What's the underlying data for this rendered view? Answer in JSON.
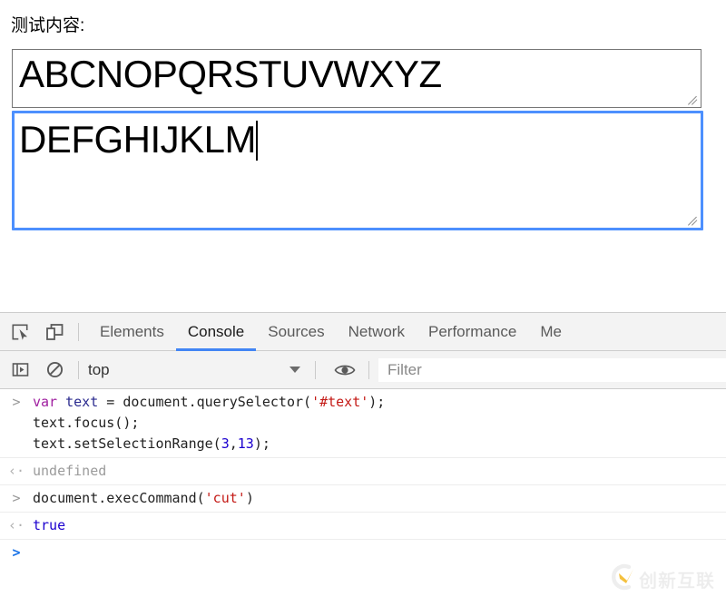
{
  "page": {
    "label": "测试内容:",
    "textarea_top": {
      "value": "ABCNOPQRSTUVWXYZ",
      "focused": false
    },
    "textarea_bottom": {
      "value": "DEFGHIJKLM",
      "focused": true,
      "caret_after_text": true
    }
  },
  "devtools": {
    "icons": {
      "inspect": "inspect-element-icon",
      "device": "device-toolbar-icon"
    },
    "tabs": [
      {
        "label": "Elements",
        "active": false
      },
      {
        "label": "Console",
        "active": true
      },
      {
        "label": "Sources",
        "active": false
      },
      {
        "label": "Network",
        "active": false
      },
      {
        "label": "Performance",
        "active": false
      },
      {
        "label": "Me",
        "active": false
      }
    ],
    "active_tab_color": "#4285f4",
    "toolbar": {
      "sidebar_toggle": "console-sidebar-icon",
      "clear_console": "clear-console-icon",
      "context_value": "top",
      "eye_icon": "live-expression-eye-icon",
      "filter_placeholder": "Filter"
    },
    "console_rows": [
      {
        "kind": "input",
        "gutter": ">",
        "lines": [
          [
            {
              "t": "var",
              "c": "kw"
            },
            {
              "t": " ",
              "c": "plain"
            },
            {
              "t": "text",
              "c": "var"
            },
            {
              "t": " = document.querySelector(",
              "c": "plain"
            },
            {
              "t": "'#text'",
              "c": "str"
            },
            {
              "t": ");",
              "c": "plain"
            }
          ],
          [
            {
              "t": "text.focus();",
              "c": "plain"
            }
          ],
          [
            {
              "t": "text.setSelectionRange(",
              "c": "plain"
            },
            {
              "t": "3",
              "c": "num"
            },
            {
              "t": ",",
              "c": "plain"
            },
            {
              "t": "13",
              "c": "num"
            },
            {
              "t": ");",
              "c": "plain"
            }
          ]
        ]
      },
      {
        "kind": "output",
        "gutter": "‹·",
        "lines": [
          [
            {
              "t": "undefined",
              "c": "undefined"
            }
          ]
        ]
      },
      {
        "kind": "input",
        "gutter": ">",
        "lines": [
          [
            {
              "t": "document.execCommand(",
              "c": "plain"
            },
            {
              "t": "'cut'",
              "c": "str"
            },
            {
              "t": ")",
              "c": "plain"
            }
          ]
        ]
      },
      {
        "kind": "output",
        "gutter": "‹·",
        "lines": [
          [
            {
              "t": "true",
              "c": "true"
            }
          ]
        ]
      },
      {
        "kind": "prompt",
        "gutter": ">",
        "lines": [
          [
            {
              "t": "",
              "c": "plain"
            }
          ]
        ]
      }
    ]
  },
  "watermark": {
    "text": "创新互联",
    "logo": "circle-x-logo-icon",
    "logo_accent": "#f3b61d"
  }
}
